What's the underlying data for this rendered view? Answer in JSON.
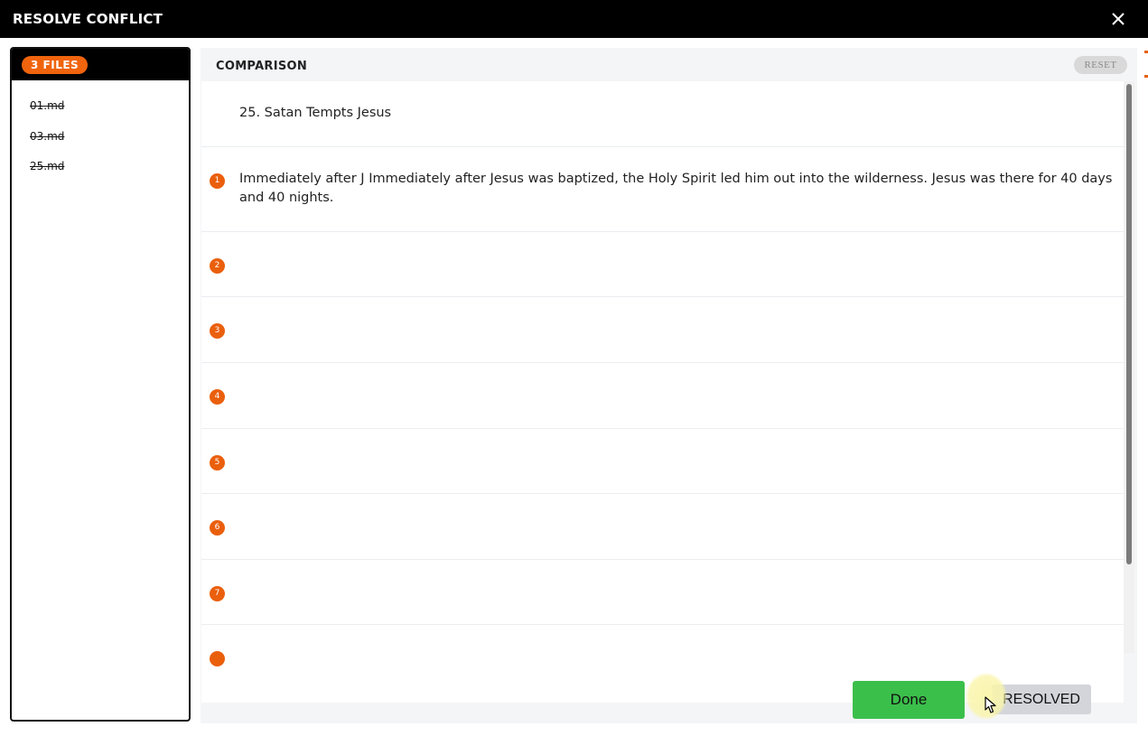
{
  "window": {
    "title": "RESOLVE CONFLICT"
  },
  "files": {
    "count_badge": "3 FILES",
    "items": [
      "01.md",
      "03.md",
      "25.md"
    ]
  },
  "comparison": {
    "header": "COMPARISON",
    "reset_label": "RESET",
    "heading_line": "25. Satan Tempts Jesus",
    "rows": [
      {
        "number": "1",
        "text": "Immediately after J Immediately after Jesus was baptized, the Holy Spirit led him out into the wilderness. Jesus was there for 40 days and 40 nights."
      },
      {
        "number": "2",
        "text": ""
      },
      {
        "number": "3",
        "text": ""
      },
      {
        "number": "4",
        "text": ""
      },
      {
        "number": "5",
        "text": ""
      },
      {
        "number": "6",
        "text": ""
      },
      {
        "number": "7",
        "text": ""
      }
    ]
  },
  "footer": {
    "done_label": "Done",
    "resolved_label": "RESOLVED"
  },
  "colors": {
    "accent": "#f0640d",
    "done": "#3bbf4b",
    "titlebar": "#000000"
  }
}
